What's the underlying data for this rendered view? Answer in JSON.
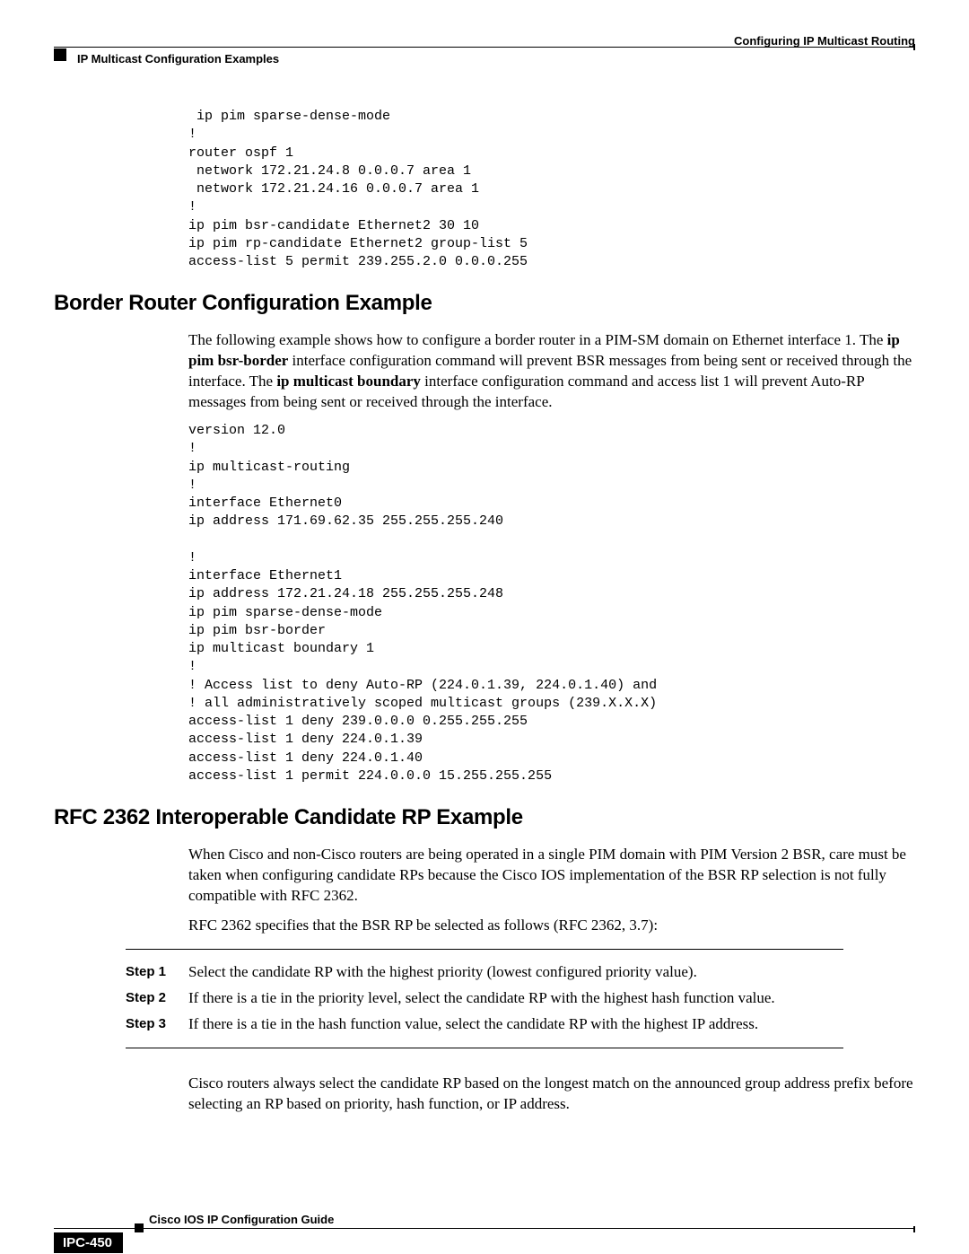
{
  "running_head": {
    "module": "Configuring IP Multicast Routing",
    "section": "IP Multicast Configuration Examples"
  },
  "code_block_1": " ip pim sparse-dense-mode\n!\nrouter ospf 1\n network 172.21.24.8 0.0.0.7 area 1\n network 172.21.24.16 0.0.0.7 area 1\n!\nip pim bsr-candidate Ethernet2 30 10\nip pim rp-candidate Ethernet2 group-list 5\naccess-list 5 permit 239.255.2.0 0.0.0.255",
  "section1": {
    "heading": "Border Router Configuration Example",
    "para_parts": {
      "p1a": "The following example shows how to configure a border router in a PIM-SM domain on Ethernet interface 1. The ",
      "p1b": "ip pim bsr-border",
      "p1c": " interface configuration command will prevent BSR messages from being sent or received through the interface. The ",
      "p1d": "ip multicast boundary",
      "p1e": " interface configuration command and access list 1 will prevent Auto-RP messages from being sent or received through the interface."
    },
    "code": "version 12.0\n!\nip multicast-routing\n!\ninterface Ethernet0\nip address 171.69.62.35 255.255.255.240\n\n!\ninterface Ethernet1\nip address 172.21.24.18 255.255.255.248\nip pim sparse-dense-mode\nip pim bsr-border\nip multicast boundary 1\n!\n! Access list to deny Auto-RP (224.0.1.39, 224.0.1.40) and\n! all administratively scoped multicast groups (239.X.X.X)\naccess-list 1 deny 239.0.0.0 0.255.255.255\naccess-list 1 deny 224.0.1.39\naccess-list 1 deny 224.0.1.40\naccess-list 1 permit 224.0.0.0 15.255.255.255"
  },
  "section2": {
    "heading": "RFC 2362 Interoperable Candidate RP Example",
    "para1": "When Cisco and non-Cisco routers are being operated in a single PIM domain with PIM Version 2 BSR, care must be taken when configuring candidate RPs because the Cisco IOS implementation of the BSR RP selection is not fully compatible with RFC 2362.",
    "para2": "RFC 2362 specifies that the BSR RP be selected as follows (RFC 2362, 3.7):",
    "steps": [
      {
        "label": "Step 1",
        "text": "Select the candidate RP with the highest priority (lowest configured priority value)."
      },
      {
        "label": "Step 2",
        "text": "If there is a tie in the priority level, select the candidate RP with the highest hash function value."
      },
      {
        "label": "Step 3",
        "text": "If there is a tie in the hash function value, select the candidate RP with the highest IP address."
      }
    ],
    "para3": "Cisco routers always select the candidate RP based on the longest match on the announced group address prefix before selecting an RP based on priority, hash function, or IP address."
  },
  "footer": {
    "book": "Cisco IOS IP Configuration Guide",
    "pagenum": "IPC-450"
  }
}
